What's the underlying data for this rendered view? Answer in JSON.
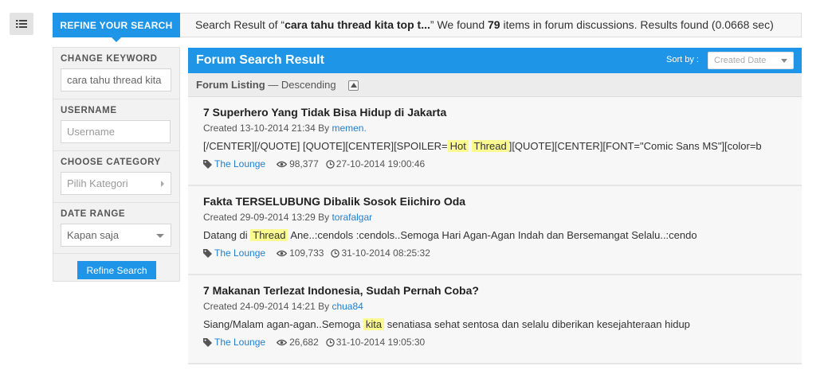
{
  "top": {
    "refine_tab": "REFINE YOUR SEARCH",
    "summary_prefix": "Search Result of “",
    "query_shown": "cara tahu thread kita top t...",
    "summary_mid": "” We found ",
    "count": "79",
    "summary_suffix": " items in forum discussions. Results found (0.0668 sec)"
  },
  "sidebar": {
    "keyword_label": "CHANGE KEYWORD",
    "keyword_value": "cara tahu thread kita",
    "username_label": "USERNAME",
    "username_placeholder": "Username",
    "category_label": "CHOOSE CATEGORY",
    "category_value": "Pilih Kategori",
    "date_label": "DATE RANGE",
    "date_value": "Kapan saja",
    "refine_button": "Refine Search"
  },
  "main": {
    "title": "Forum Search Result",
    "sort_label": "Sort by :",
    "sort_value": "Created Date",
    "listing_label": "Forum Listing",
    "listing_order": " — Descending"
  },
  "threads": [
    {
      "title": "7 Superhero Yang Tidak Bisa Hidup di Jakarta",
      "created_prefix": "Created 13-10-2014 21:34 By ",
      "author": "memen.",
      "snippet_parts": [
        "[/CENTER][/QUOTE] [QUOTE][CENTER][SPOILER=",
        "Hot",
        " ",
        "Thread",
        "][QUOTE][CENTER][FONT=\"Comic Sans MS\"][color=b"
      ],
      "forum": "The Lounge",
      "views": "98,377",
      "last_post": "27-10-2014 19:00:46"
    },
    {
      "title": "Fakta TERSELUBUNG Dibalik Sosok Eiichiro Oda",
      "created_prefix": "Created 29-09-2014 13:29 By ",
      "author": "torafalgar",
      "snippet_parts": [
        "Datang di ",
        "Thread",
        " Ane..:cendols :cendols..Semoga Hari Agan-Agan Indah dan Bersemangat Selalu..:cendo"
      ],
      "forum": "The Lounge",
      "views": "109,733",
      "last_post": "31-10-2014 08:25:32"
    },
    {
      "title": "7 Makanan Terlezat Indonesia, Sudah Pernah Coba?",
      "created_prefix": "Created 24-09-2014 14:21 By ",
      "author": "chua84",
      "snippet_parts": [
        "Siang/Malam agan-agan..Semoga ",
        "kita",
        " senatiasa sehat sentosa dan selalu diberikan kesejahteraan hidup"
      ],
      "forum": "The Lounge",
      "views": "26,682",
      "last_post": "31-10-2014 19:05:30"
    }
  ],
  "colors": {
    "accent": "#1e95e6",
    "link": "#1e7fd0",
    "highlight": "#fafa91"
  },
  "icons": [
    "list-icon",
    "tag-icon",
    "eye-icon",
    "clock-icon"
  ]
}
